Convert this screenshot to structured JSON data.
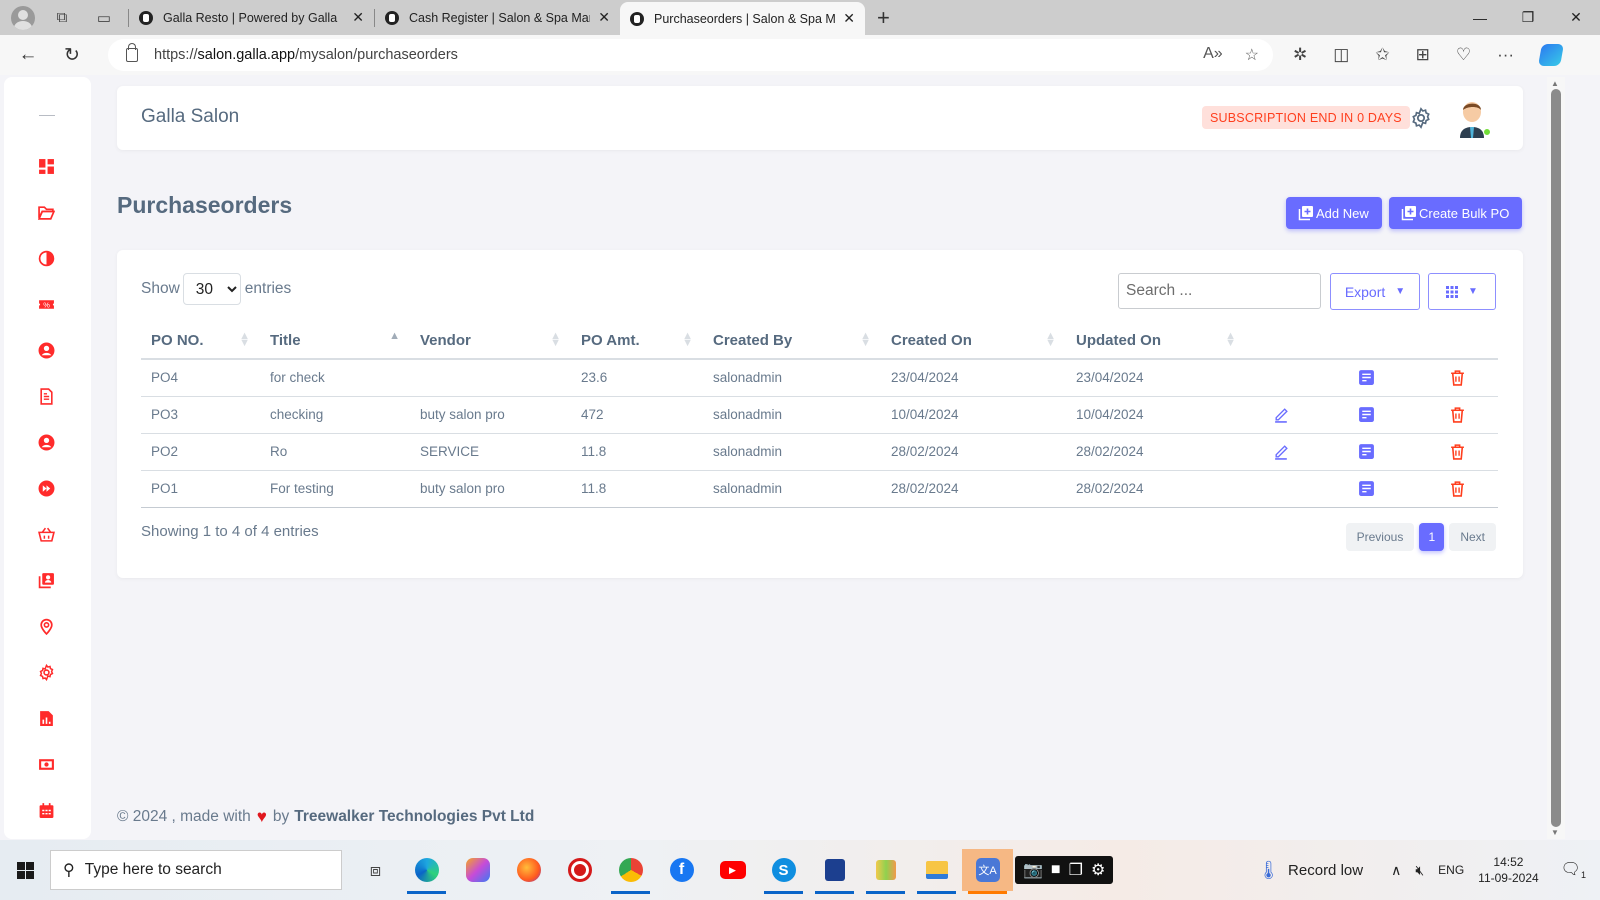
{
  "browser": {
    "tabs": [
      {
        "title": "Galla Resto | Powered by Galla",
        "active": false
      },
      {
        "title": "Cash Register | Salon & Spa Mana",
        "active": false
      },
      {
        "title": "Purchaseorders | Salon & Spa Mar",
        "active": true
      }
    ],
    "url_prefix": "https://",
    "url_host": "salon.galla.app",
    "url_path": "/mysalon/purchaseorders"
  },
  "sidebar": {
    "items": [
      {
        "icon": "dashboard-icon"
      },
      {
        "icon": "folder-open-icon"
      },
      {
        "icon": "contrast-icon"
      },
      {
        "icon": "discount-ticket-icon"
      },
      {
        "icon": "user-circle-icon"
      },
      {
        "icon": "document-icon"
      },
      {
        "icon": "user-circle-icon"
      },
      {
        "icon": "fast-forward-icon"
      },
      {
        "icon": "basket-icon"
      },
      {
        "icon": "contact-list-icon"
      },
      {
        "icon": "location-pin-icon"
      },
      {
        "icon": "gear-icon"
      },
      {
        "icon": "report-icon"
      },
      {
        "icon": "cash-icon"
      },
      {
        "icon": "calendar-icon"
      }
    ],
    "accent": "#ff2b2b"
  },
  "header": {
    "brand": "Galla Salon",
    "subscription_badge": "SUBSCRIPTION END IN 0 DAYS"
  },
  "page": {
    "title": "Purchaseorders",
    "add_new_label": "Add New",
    "bulk_po_label": "Create Bulk PO"
  },
  "table_controls": {
    "show_label": "Show",
    "entries_label": "entries",
    "page_size": "30",
    "search_placeholder": "Search ...",
    "export_label": "Export"
  },
  "table": {
    "columns": [
      "PO NO.",
      "Title",
      "Vendor",
      "PO Amt.",
      "Created By",
      "Created On",
      "Updated On"
    ],
    "rows": [
      {
        "po_no": "PO4",
        "title": "for check",
        "vendor": "",
        "amount": "23.6",
        "created_by": "salonadmin",
        "created_on": "23/04/2024",
        "updated_on": "23/04/2024",
        "editable": false
      },
      {
        "po_no": "PO3",
        "title": "checking",
        "vendor": "buty salon pro",
        "amount": "472",
        "created_by": "salonadmin",
        "created_on": "10/04/2024",
        "updated_on": "10/04/2024",
        "editable": true
      },
      {
        "po_no": "PO2",
        "title": "Ro",
        "vendor": "SERVICE",
        "amount": "11.8",
        "created_by": "salonadmin",
        "created_on": "28/02/2024",
        "updated_on": "28/02/2024",
        "editable": true
      },
      {
        "po_no": "PO1",
        "title": "For testing",
        "vendor": "buty salon pro",
        "amount": "11.8",
        "created_by": "salonadmin",
        "created_on": "28/02/2024",
        "updated_on": "28/02/2024",
        "editable": false
      }
    ],
    "sorted_column": "Title"
  },
  "pagination": {
    "info": "Showing 1 to 4 of 4 entries",
    "previous": "Previous",
    "current": "1",
    "next": "Next"
  },
  "footer": {
    "prefix": "© 2024 , made with",
    "by": "by",
    "company": "Treewalker Technologies Pvt Ltd"
  },
  "taskbar": {
    "search_placeholder": "Type here to search",
    "weather": "Record low",
    "language": "ENG",
    "time": "14:52",
    "date": "11-09-2024",
    "notifications": "1"
  },
  "colors": {
    "primary": "#696cff",
    "danger": "#ff3e1d",
    "text": "#566a7f"
  }
}
